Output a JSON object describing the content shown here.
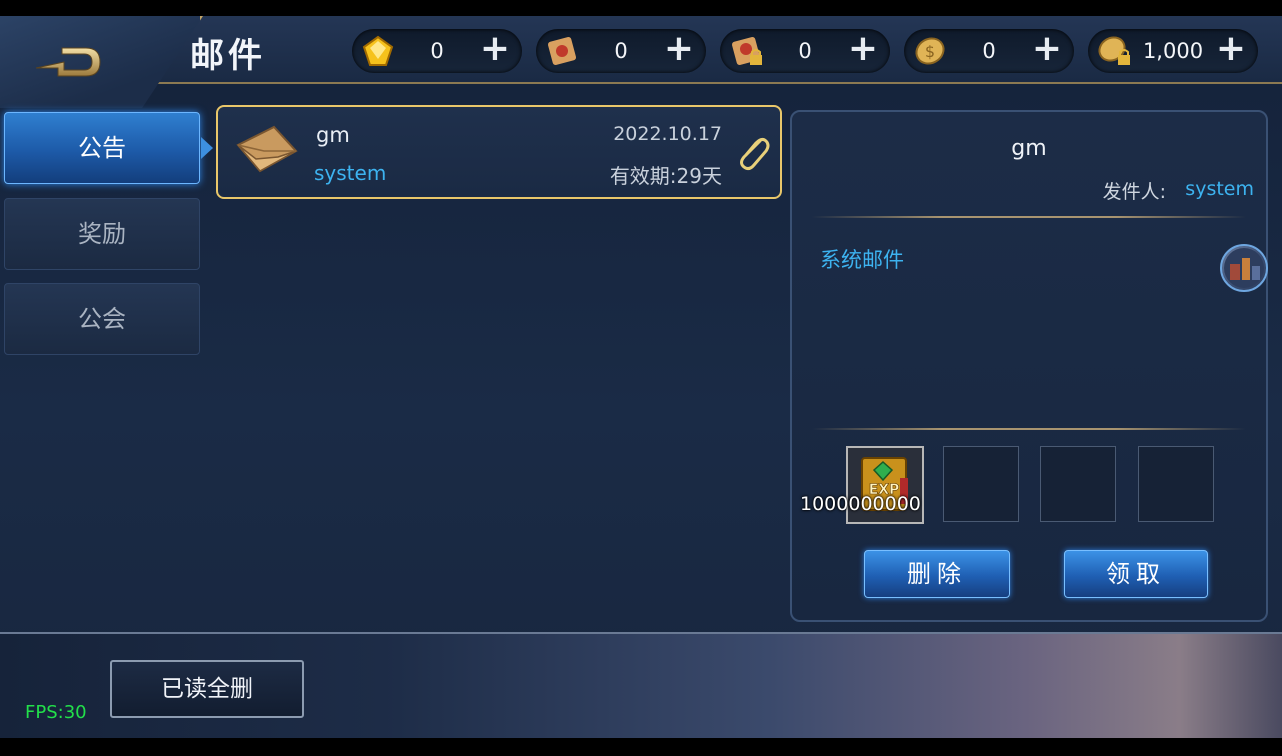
{
  "header": {
    "title": "邮件",
    "back_icon": "back-arrow-icon"
  },
  "resources": [
    {
      "icon": "diamond-icon",
      "value": "0",
      "plus": "+"
    },
    {
      "icon": "scroll-icon",
      "value": "0",
      "plus": "+"
    },
    {
      "icon": "locked-scroll-icon",
      "value": "0",
      "plus": "+"
    },
    {
      "icon": "gold-coin-icon",
      "value": "0",
      "plus": "+"
    },
    {
      "icon": "locked-coin-icon",
      "value": "1,000",
      "plus": "+"
    }
  ],
  "tabs": [
    {
      "label": "公告",
      "active": true
    },
    {
      "label": "奖励",
      "active": false
    },
    {
      "label": "公会",
      "active": false
    }
  ],
  "mail_list": [
    {
      "subject": "gm",
      "sender": "system",
      "date": "2022.10.17",
      "expire": "有效期:29天",
      "has_attachment": true
    }
  ],
  "detail": {
    "subject": "gm",
    "sender_label": "发件人:",
    "sender_value": "system",
    "body": "系统邮件",
    "attachments": [
      {
        "icon": "exp-book-icon",
        "quantity": "1000000000"
      },
      null,
      null,
      null
    ],
    "delete_label": "删除",
    "claim_label": "领取"
  },
  "footer": {
    "read_delete_all": "已读全删",
    "fps": "FPS:30"
  },
  "colors": {
    "accent_blue": "#3db3f0",
    "gold_border": "#e9c76a",
    "fps_green": "#22e04a"
  }
}
